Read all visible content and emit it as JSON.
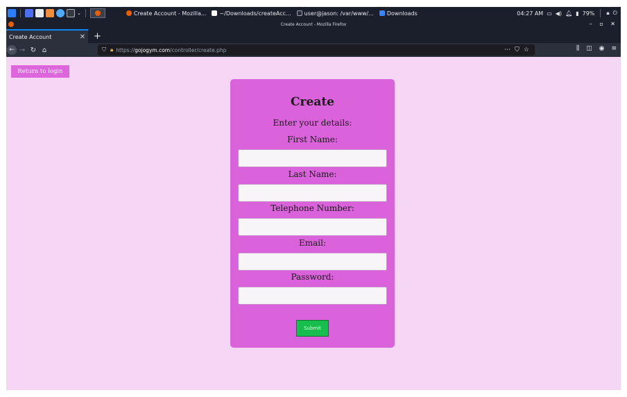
{
  "taskbar": {
    "tasks": [
      {
        "label": "Create Account - Mozilla...",
        "color": "#e66000"
      },
      {
        "label": "~/Downloads/createAcc...",
        "color": "#ffffff"
      },
      {
        "label": "user@jason: /var/www/...",
        "color": "#9aa0ad"
      },
      {
        "label": "Downloads",
        "color": "#3b82f6"
      }
    ],
    "clock": "04:27 AM",
    "battery": "79%"
  },
  "window": {
    "title": "Create Account - Mozilla Firefox",
    "tab_title": "Create Account",
    "url_scheme": "https://",
    "url_domain": "gojogym.com",
    "url_path": "/controller/create.php"
  },
  "page": {
    "return_button": "Return to login",
    "heading": "Create",
    "subheading": "Enter your details:",
    "fields": [
      {
        "label": "First Name:",
        "value": ""
      },
      {
        "label": "Last Name:",
        "value": ""
      },
      {
        "label": "Telephone Number:",
        "value": ""
      },
      {
        "label": "Email:",
        "value": ""
      },
      {
        "label": "Password:",
        "value": ""
      }
    ],
    "submit_label": "Submit"
  },
  "colors": {
    "page_background": "#f5d6f5",
    "card_background": "#da62da",
    "submit_button": "#18bd4e",
    "return_button": "#dd66dd"
  }
}
